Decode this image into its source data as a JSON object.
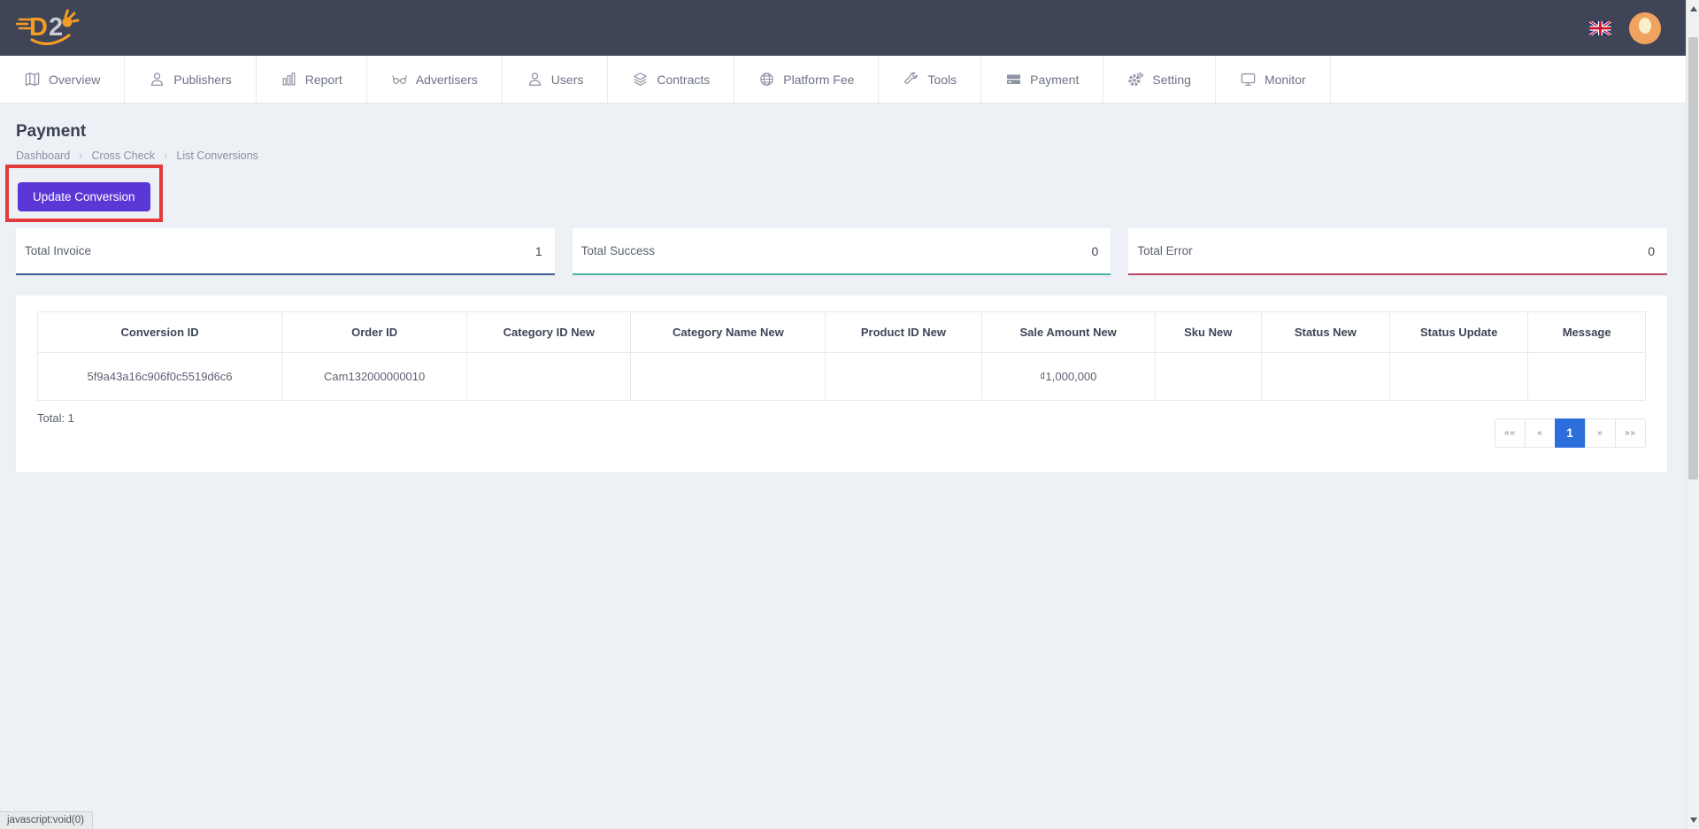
{
  "topbar": {
    "logo": {
      "d": "D",
      "two": "2"
    }
  },
  "nav": {
    "items": [
      {
        "label": "Overview"
      },
      {
        "label": "Publishers"
      },
      {
        "label": "Report"
      },
      {
        "label": "Advertisers"
      },
      {
        "label": "Users"
      },
      {
        "label": "Contracts"
      },
      {
        "label": "Platform Fee"
      },
      {
        "label": "Tools"
      },
      {
        "label": "Payment"
      },
      {
        "label": "Setting"
      },
      {
        "label": "Monitor"
      }
    ]
  },
  "page": {
    "title": "Payment",
    "breadcrumb": [
      "Dashboard",
      "Cross Check",
      "List Conversions"
    ],
    "breadcrumb_separator": "›"
  },
  "actions": {
    "update_button": "Update Conversion"
  },
  "stats": {
    "cards": [
      {
        "label": "Total Invoice",
        "value": "1",
        "color": "#3c5a96"
      },
      {
        "label": "Total Success",
        "value": "0",
        "color": "#4cb2a6"
      },
      {
        "label": "Total Error",
        "value": "0",
        "color": "#b64a63"
      }
    ]
  },
  "table": {
    "columns": [
      "Conversion ID",
      "Order ID",
      "Category ID New",
      "Category Name New",
      "Product ID New",
      "Sale Amount New",
      "Sku New",
      "Status New",
      "Status Update",
      "Message"
    ],
    "rows": [
      {
        "cells": [
          "5f9a43a16c906f0c5519d6c6",
          "Cam132000000010",
          "",
          "",
          "",
          "₫1,000,000",
          "",
          "",
          "",
          ""
        ]
      }
    ],
    "total_label": "Total: 1"
  },
  "pagination": {
    "first": "««",
    "prev": "«",
    "page": "1",
    "next": "»",
    "last": "»»",
    "active_color": "#2c6edb"
  },
  "statusbar": {
    "text": "javascript:void(0)"
  },
  "annotation": {
    "highlight_color": "#e23b3b"
  },
  "colors": {
    "topbar_bg": "#3f4456",
    "primary_button": "#5b38d6",
    "brand_orange": "#f59d22"
  }
}
